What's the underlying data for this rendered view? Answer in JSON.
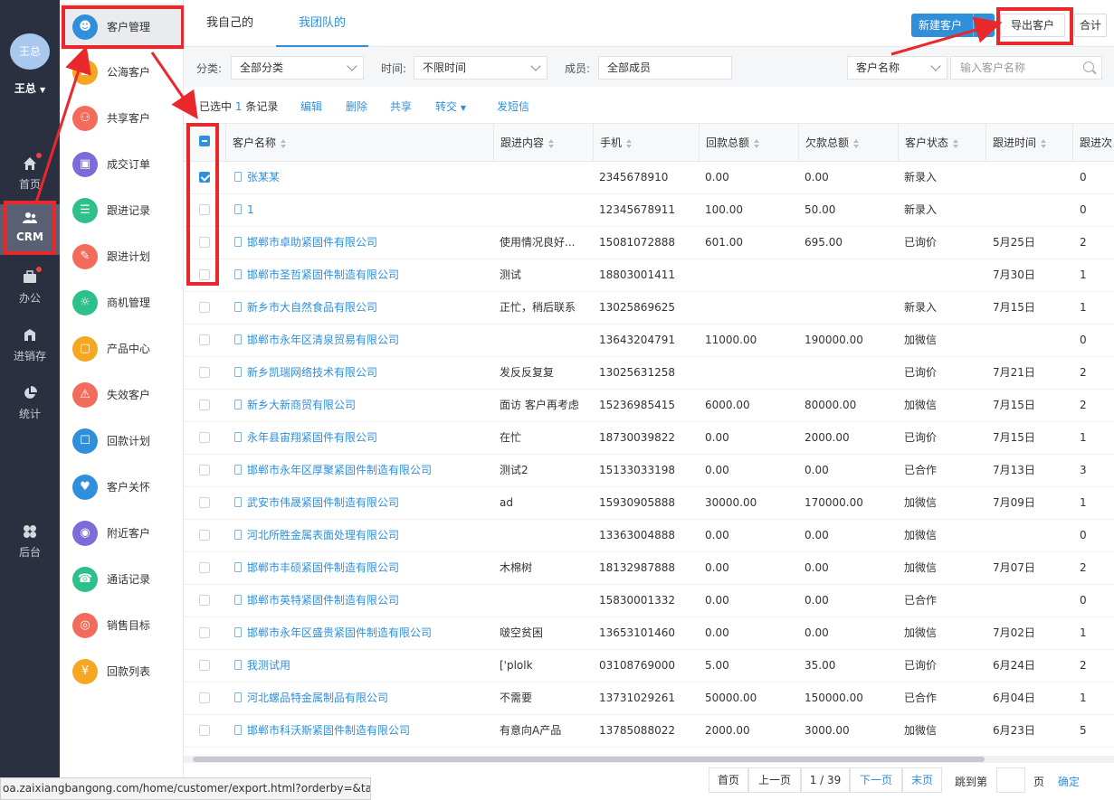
{
  "user": {
    "avatar_text": "王总",
    "name": "王总"
  },
  "rail": [
    {
      "label": "首页",
      "icon": "home-icon"
    },
    {
      "label": "CRM",
      "icon": "crm-users-icon"
    },
    {
      "label": "办公",
      "icon": "briefcase-icon"
    },
    {
      "label": "进销存",
      "icon": "inventory-icon"
    },
    {
      "label": "统计",
      "icon": "pie-chart-icon"
    },
    {
      "label": "后台",
      "icon": "clover-icon"
    }
  ],
  "submenu": [
    {
      "label": "客户管理",
      "icon": "customer-icon",
      "color": "#2f8fdb"
    },
    {
      "label": "公海客户",
      "icon": "public-customer-icon",
      "color": "#f5a623"
    },
    {
      "label": "共享客户",
      "icon": "share-icon",
      "color": "#f26b5b"
    },
    {
      "label": "成交订单",
      "icon": "order-icon",
      "color": "#7b6cd9"
    },
    {
      "label": "跟进记录",
      "icon": "record-icon",
      "color": "#2ec08a"
    },
    {
      "label": "跟进计划",
      "icon": "plan-icon",
      "color": "#f26b5b"
    },
    {
      "label": "商机管理",
      "icon": "bulb-icon",
      "color": "#2ec08a"
    },
    {
      "label": "产品中心",
      "icon": "box-icon",
      "color": "#f5a623"
    },
    {
      "label": "失效客户",
      "icon": "warning-icon",
      "color": "#f26b5b"
    },
    {
      "label": "回款计划",
      "icon": "payment-plan-icon",
      "color": "#2f8fdb"
    },
    {
      "label": "客户关怀",
      "icon": "care-icon",
      "color": "#2f8fdb"
    },
    {
      "label": "附近客户",
      "icon": "location-icon",
      "color": "#7b6cd9"
    },
    {
      "label": "通话记录",
      "icon": "phone-icon",
      "color": "#2ec08a"
    },
    {
      "label": "销售目标",
      "icon": "target-icon",
      "color": "#f26b5b"
    },
    {
      "label": "回款列表",
      "icon": "payment-list-icon",
      "color": "#f5a623"
    }
  ],
  "tabs": [
    "我自己的",
    "我团队的"
  ],
  "toolbar": {
    "new_customer": "新建客户",
    "export": "导出客户",
    "total": "合计"
  },
  "filters": {
    "category_label": "分类:",
    "category_value": "全部分类",
    "time_label": "时间:",
    "time_value": "不限时间",
    "member_label": "成员:",
    "member_value": "全部成员",
    "search_field": "客户名称",
    "search_placeholder": "输入客户名称"
  },
  "selection": {
    "prefix": "已选中",
    "count": "1",
    "suffix": "条记录"
  },
  "actions": [
    "编辑",
    "删除",
    "共享",
    "转交",
    "发短信"
  ],
  "columns": [
    "客户名称",
    "跟进内容",
    "手机",
    "回款总额",
    "欠款总额",
    "客户状态",
    "跟进时间",
    "跟进次"
  ],
  "rows": [
    {
      "checked": true,
      "name": "张某某",
      "content": "",
      "phone": "2345678910",
      "paid": "0.00",
      "owed": "0.00",
      "status": "新录入",
      "time": "",
      "count": "0"
    },
    {
      "checked": false,
      "name": "1",
      "content": "",
      "phone": "12345678911",
      "paid": "100.00",
      "owed": "50.00",
      "status": "新录入",
      "time": "",
      "count": "0"
    },
    {
      "checked": false,
      "name": "邯郸市卓助紧固件有限公司",
      "content": "使用情况良好...",
      "phone": "15081072888",
      "paid": "601.00",
      "owed": "695.00",
      "status": "已询价",
      "time": "5月25日",
      "count": "2"
    },
    {
      "checked": false,
      "name": "邯郸市圣哲紧固件制造有限公司",
      "content": "测试",
      "phone": "18803001411",
      "paid": "",
      "owed": "",
      "status": "",
      "time": "7月30日",
      "count": "1"
    },
    {
      "checked": false,
      "name": "新乡市大自然食品有限公司",
      "content": "正忙，稍后联系",
      "phone": "13025869625",
      "paid": "",
      "owed": "",
      "status": "新录入",
      "time": "7月15日",
      "count": "1"
    },
    {
      "checked": false,
      "name": "邯郸市永年区清泉贸易有限公司",
      "content": "",
      "phone": "13643204791",
      "paid": "11000.00",
      "owed": "190000.00",
      "status": "加微信",
      "time": "",
      "count": "0"
    },
    {
      "checked": false,
      "name": "新乡凯瑞网络技术有限公司",
      "content": "发反反复复",
      "phone": "13025631258",
      "paid": "",
      "owed": "",
      "status": "已询价",
      "time": "7月21日",
      "count": "2"
    },
    {
      "checked": false,
      "name": "新乡大新商贸有限公司",
      "content": "面访 客户再考虑",
      "phone": "15236985415",
      "paid": "6000.00",
      "owed": "80000.00",
      "status": "加微信",
      "time": "7月15日",
      "count": "2"
    },
    {
      "checked": false,
      "name": "永年县宙翔紧固件有限公司",
      "content": "在忙",
      "phone": "18730039822",
      "paid": "0.00",
      "owed": "2000.00",
      "status": "已询价",
      "time": "7月15日",
      "count": "1"
    },
    {
      "checked": false,
      "name": "邯郸市永年区厚聚紧固件制造有限公司",
      "content": "测试2",
      "phone": "15133033198",
      "paid": "0.00",
      "owed": "0.00",
      "status": "已合作",
      "time": "7月13日",
      "count": "3"
    },
    {
      "checked": false,
      "name": "武安市伟晟紧固件制造有限公司",
      "content": "ad",
      "phone": "15930905888",
      "paid": "30000.00",
      "owed": "170000.00",
      "status": "加微信",
      "time": "7月09日",
      "count": "1"
    },
    {
      "checked": false,
      "name": "河北所胜金属表面处理有限公司",
      "content": "",
      "phone": "13363004888",
      "paid": "0.00",
      "owed": "0.00",
      "status": "加微信",
      "time": "",
      "count": "0"
    },
    {
      "checked": false,
      "name": "邯郸市丰硕紧固件制造有限公司",
      "content": "木棉树",
      "phone": "18132987888",
      "paid": "0.00",
      "owed": "0.00",
      "status": "加微信",
      "time": "7月07日",
      "count": "2"
    },
    {
      "checked": false,
      "name": "邯郸市英特紧固件制造有限公司",
      "content": "",
      "phone": "15830001332",
      "paid": "0.00",
      "owed": "0.00",
      "status": "已合作",
      "time": "",
      "count": "0"
    },
    {
      "checked": false,
      "name": "邯郸市永年区盛贵紧固件制造有限公司",
      "content": "啵空贫困",
      "phone": "13653101460",
      "paid": "0.00",
      "owed": "0.00",
      "status": "加微信",
      "time": "7月02日",
      "count": "1"
    },
    {
      "checked": false,
      "name": "我测试用",
      "content": "['plolk",
      "phone": "03108769000",
      "paid": "5.00",
      "owed": "35.00",
      "status": "已询价",
      "time": "6月24日",
      "count": "2"
    },
    {
      "checked": false,
      "name": "河北螺品特金属制品有限公司",
      "content": "不需要",
      "phone": "13731029261",
      "paid": "50000.00",
      "owed": "150000.00",
      "status": "已合作",
      "time": "6月04日",
      "count": "1"
    },
    {
      "checked": false,
      "name": "邯郸市科沃斯紧固件制造有限公司",
      "content": "有意向A产品",
      "phone": "13785088022",
      "paid": "2000.00",
      "owed": "3000.00",
      "status": "加微信",
      "time": "6月23日",
      "count": "5"
    }
  ],
  "pagination": {
    "first": "首页",
    "prev": "上一页",
    "page": "1 / 39",
    "next": "下一页",
    "last": "末页",
    "jump_label": "跳到第",
    "page_unit": "页",
    "confirm": "确定"
  },
  "status_url": "oa.zaixiangbangong.com/home/customer/export.html?orderby=&ta..."
}
